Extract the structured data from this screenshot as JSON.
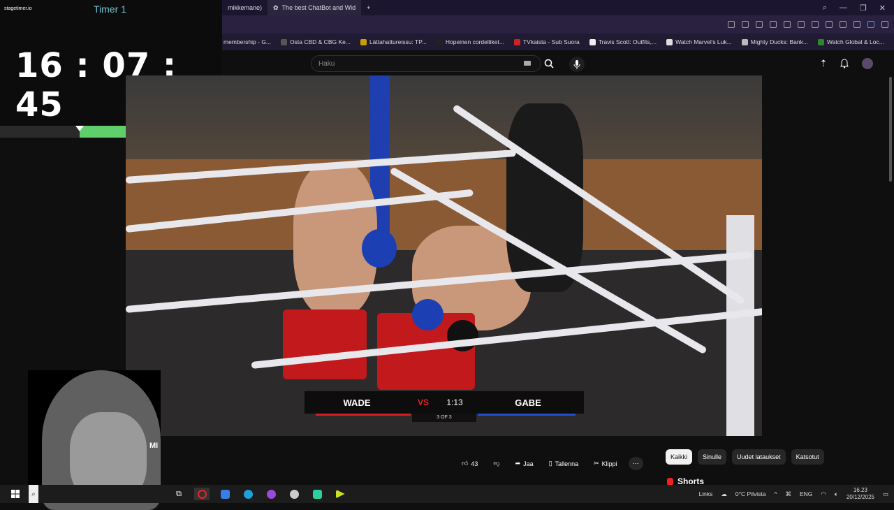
{
  "timer": {
    "logo": "stagetimer.io",
    "title": "Timer 1",
    "time": "16 : 07 : 45",
    "progress": 0.64
  },
  "browser": {
    "tabs": [
      {
        "label": "mikkemane)"
      },
      {
        "label": "The best ChatBot and Wid"
      }
    ],
    "new_tab": "+",
    "window_controls": [
      "—",
      "❐",
      "✕"
    ]
  },
  "bookmarks": [
    "membership - G...",
    "Osta CBD & CBG Ke...",
    "Lättahattureissu: TP...",
    "Hopeinen cordelliket...",
    "TVkaista - Sub Suora",
    "Travis Scott: Outfits,...",
    "Watch Marvel's Luk...",
    "Mighty Ducks: Bank...",
    "Watch Global & Loc..."
  ],
  "youtube": {
    "search_placeholder": "Haku",
    "channel_fragment": "MI",
    "actions": {
      "likes": "43",
      "share": "Jaa",
      "save": "Tallenna",
      "clip": "Klippi"
    },
    "chips": [
      "Kaikki",
      "Sinulle",
      "Uudet lataukset",
      "Katsotut"
    ],
    "shorts": "Shorts"
  },
  "scoreboard": {
    "left_name": "WADE",
    "logo": "VS",
    "clock": "1:13",
    "right_name": "GABE",
    "round": "3 OF 3",
    "colors": {
      "left": "#d21f1f",
      "right": "#1f4fd0"
    }
  },
  "taskbar": {
    "links": "Links",
    "weather": "0°C  Pilvista",
    "lang": "ENG",
    "time": "16.23",
    "date": "20/12/2025"
  }
}
